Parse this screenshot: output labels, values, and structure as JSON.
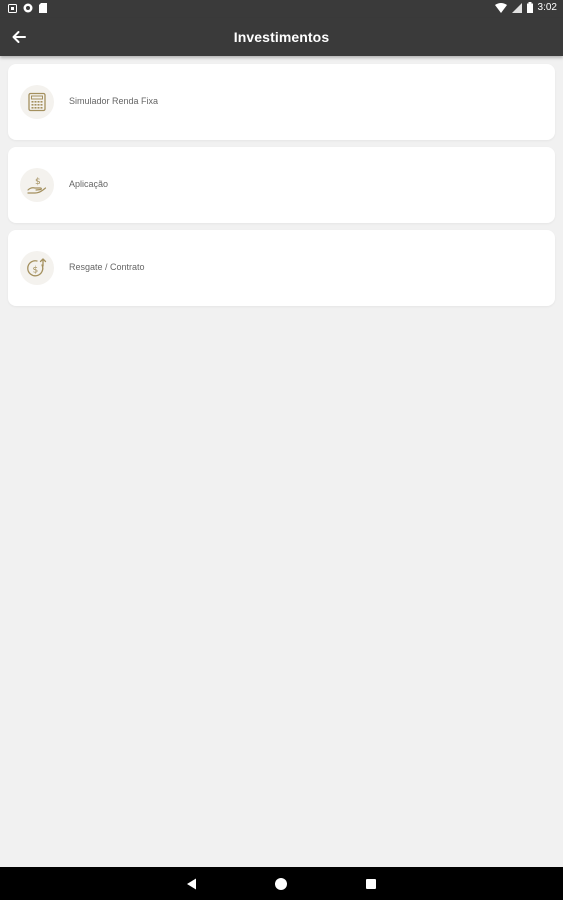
{
  "status_bar": {
    "time": "3:02"
  },
  "app_bar": {
    "title": "Investimentos"
  },
  "menu": [
    {
      "label": "Simulador Renda Fixa",
      "icon": "calculator-icon"
    },
    {
      "label": "Aplicação",
      "icon": "hand-money-icon"
    },
    {
      "label": "Resgate / Contrato",
      "icon": "coin-withdraw-icon"
    }
  ],
  "colors": {
    "bar": "#3a3a3a",
    "accent_gold": "#a4905e",
    "background": "#f1f1f1"
  }
}
